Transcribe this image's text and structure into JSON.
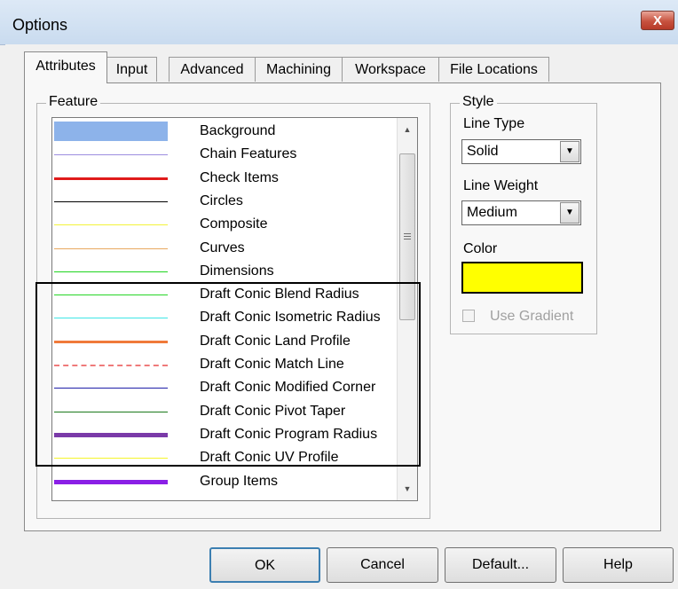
{
  "window": {
    "title": "Options",
    "close_label": "X"
  },
  "tabs": [
    {
      "label": "Attributes",
      "active": true
    },
    {
      "label": "Input"
    },
    {
      "label": "Advanced"
    },
    {
      "label": "Machining"
    },
    {
      "label": "Workspace"
    },
    {
      "label": "File Locations"
    }
  ],
  "feature_group": {
    "legend": "Feature",
    "items": [
      {
        "label": "Background",
        "color": "#8db3ea",
        "style": "fill"
      },
      {
        "label": "Chain Features",
        "color": "#9c8de0",
        "style": "solid",
        "weight": "thin"
      },
      {
        "label": "Check Items",
        "color": "#e01b1b",
        "style": "solid",
        "weight": "medium"
      },
      {
        "label": "Circles",
        "color": "#000000",
        "style": "solid",
        "weight": "thin"
      },
      {
        "label": "Composite",
        "color": "#f2f23a",
        "style": "solid",
        "weight": "thin"
      },
      {
        "label": "Curves",
        "color": "#e8a85e",
        "style": "solid",
        "weight": "thin"
      },
      {
        "label": "Dimensions",
        "color": "#1fd41f",
        "style": "solid",
        "weight": "thin"
      },
      {
        "label": "Draft Conic Blend Radius",
        "color": "#27d627",
        "style": "solid",
        "weight": "thin"
      },
      {
        "label": "Draft Conic Isometric Radius",
        "color": "#40e6e6",
        "style": "solid",
        "weight": "thin"
      },
      {
        "label": "Draft Conic Land Profile",
        "color": "#f07a3a",
        "style": "solid",
        "weight": "medium"
      },
      {
        "label": "Draft Conic Match Line",
        "color": "#ef7a7a",
        "style": "dashed",
        "weight": "thin"
      },
      {
        "label": "Draft Conic Modified Corner",
        "color": "#1f1fa8",
        "style": "solid",
        "weight": "thin"
      },
      {
        "label": "Draft Conic Pivot Taper",
        "color": "#1a7a1a",
        "style": "solid",
        "weight": "thin"
      },
      {
        "label": "Draft Conic Program Radius",
        "color": "#7a3aa8",
        "style": "solid",
        "weight": "thick"
      },
      {
        "label": "Draft Conic UV Profile",
        "color": "#f5f52a",
        "style": "solid",
        "weight": "thin"
      },
      {
        "label": "Group Items",
        "color": "#8a1fe6",
        "style": "solid",
        "weight": "thick"
      }
    ]
  },
  "style_group": {
    "legend": "Style",
    "line_type_label": "Line Type",
    "line_type_value": "Solid",
    "line_weight_label": "Line Weight",
    "line_weight_value": "Medium",
    "color_label": "Color",
    "color_value": "#ffff00",
    "use_gradient_label": "Use Gradient",
    "use_gradient_checked": false
  },
  "buttons": {
    "ok": "OK",
    "cancel": "Cancel",
    "default": "Default...",
    "help": "Help"
  },
  "icons": {
    "scroll_up": "▲",
    "scroll_down": "▼",
    "dropdown": "▼"
  }
}
